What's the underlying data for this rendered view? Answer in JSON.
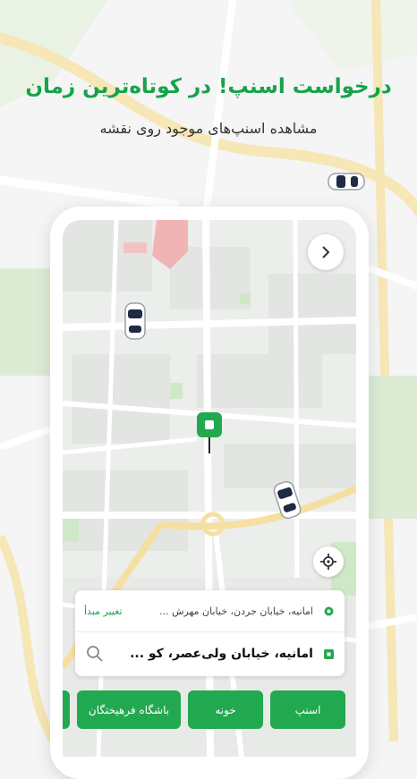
{
  "hero": {
    "title": "درخواست اسنپ! در کوتاه‌ترین زمان",
    "subtitle": "مشاهده اسنپ‌های موجود روی نقشه"
  },
  "colors": {
    "brand_green": "#22a94f",
    "title_green": "#16a34a",
    "map_road": "#ffffff",
    "map_block": "#e6e8e6",
    "map_park": "#cfe8c8",
    "map_highway": "#f6dfa2",
    "map_red_zone": "#f0b4b4"
  },
  "map": {
    "back_icon": "chevron-right-icon",
    "locate_icon": "crosshair-icon"
  },
  "address_card": {
    "origin": "امانیه، خیابان جردن، خیابان مهرش ...",
    "change_origin": "تغییر مبدأ",
    "destination": "امانیه، خیابان ولی‌عصر، کو ...",
    "search_icon": "search-icon"
  },
  "shortcuts": [
    {
      "label": "اسنپ"
    },
    {
      "label": "خونه"
    },
    {
      "label": "باشگاه فرهیختگان"
    }
  ]
}
